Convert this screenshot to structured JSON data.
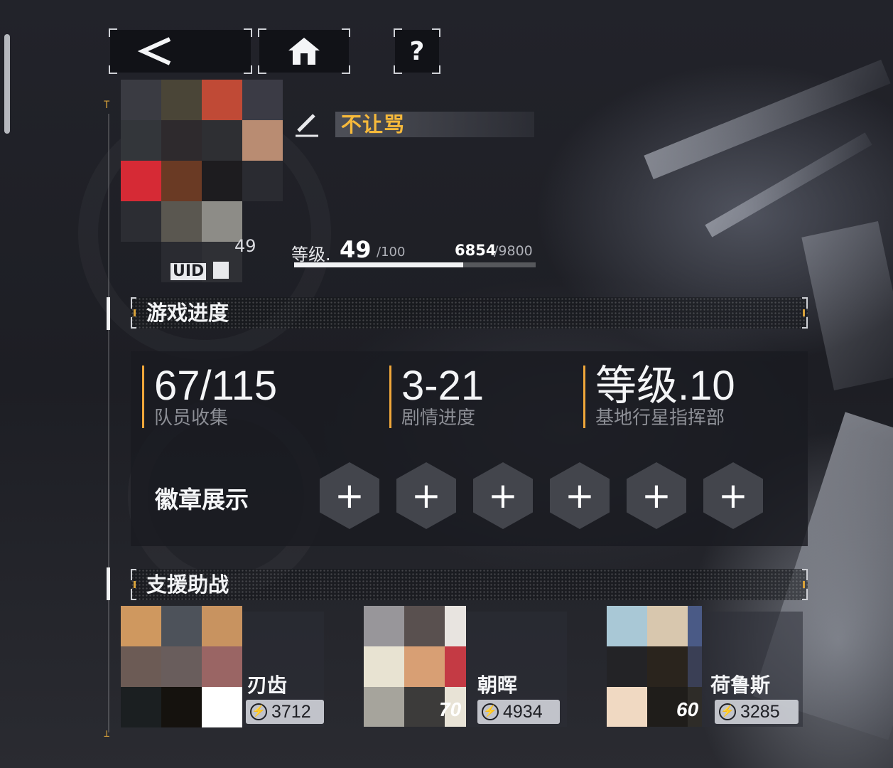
{
  "nav": {
    "back_icon": "<",
    "home_icon": "home-icon",
    "help_label": "?"
  },
  "profile": {
    "name": "不让骂",
    "uid_label": "UID",
    "uid_suffix": "49",
    "level_prefix": "等级.",
    "level": "49",
    "level_max": "/100",
    "xp_current": "6854",
    "xp_max": "/9800",
    "xp_fraction": 0.6994
  },
  "progress_section": {
    "title": "游戏进度",
    "stats": [
      {
        "value": "67/115",
        "label": "队员收集"
      },
      {
        "value": "3-21",
        "label": "剧情进度"
      },
      {
        "value": "等级.10",
        "label": "基地行星指挥部"
      }
    ],
    "badges_label": "徽章展示",
    "badge_slots": [
      "+",
      "+",
      "+",
      "+",
      "+",
      "+"
    ]
  },
  "support_section": {
    "title": "支援助战",
    "units": [
      {
        "name": "刃齿",
        "power": "3712",
        "level": ""
      },
      {
        "name": "朝晖",
        "power": "4934",
        "level": "70"
      },
      {
        "name": "荷鲁斯",
        "power": "3285",
        "level": "60"
      }
    ]
  },
  "colors": {
    "accent": "#f6b93b",
    "stat_bar": "#f0a73a"
  }
}
